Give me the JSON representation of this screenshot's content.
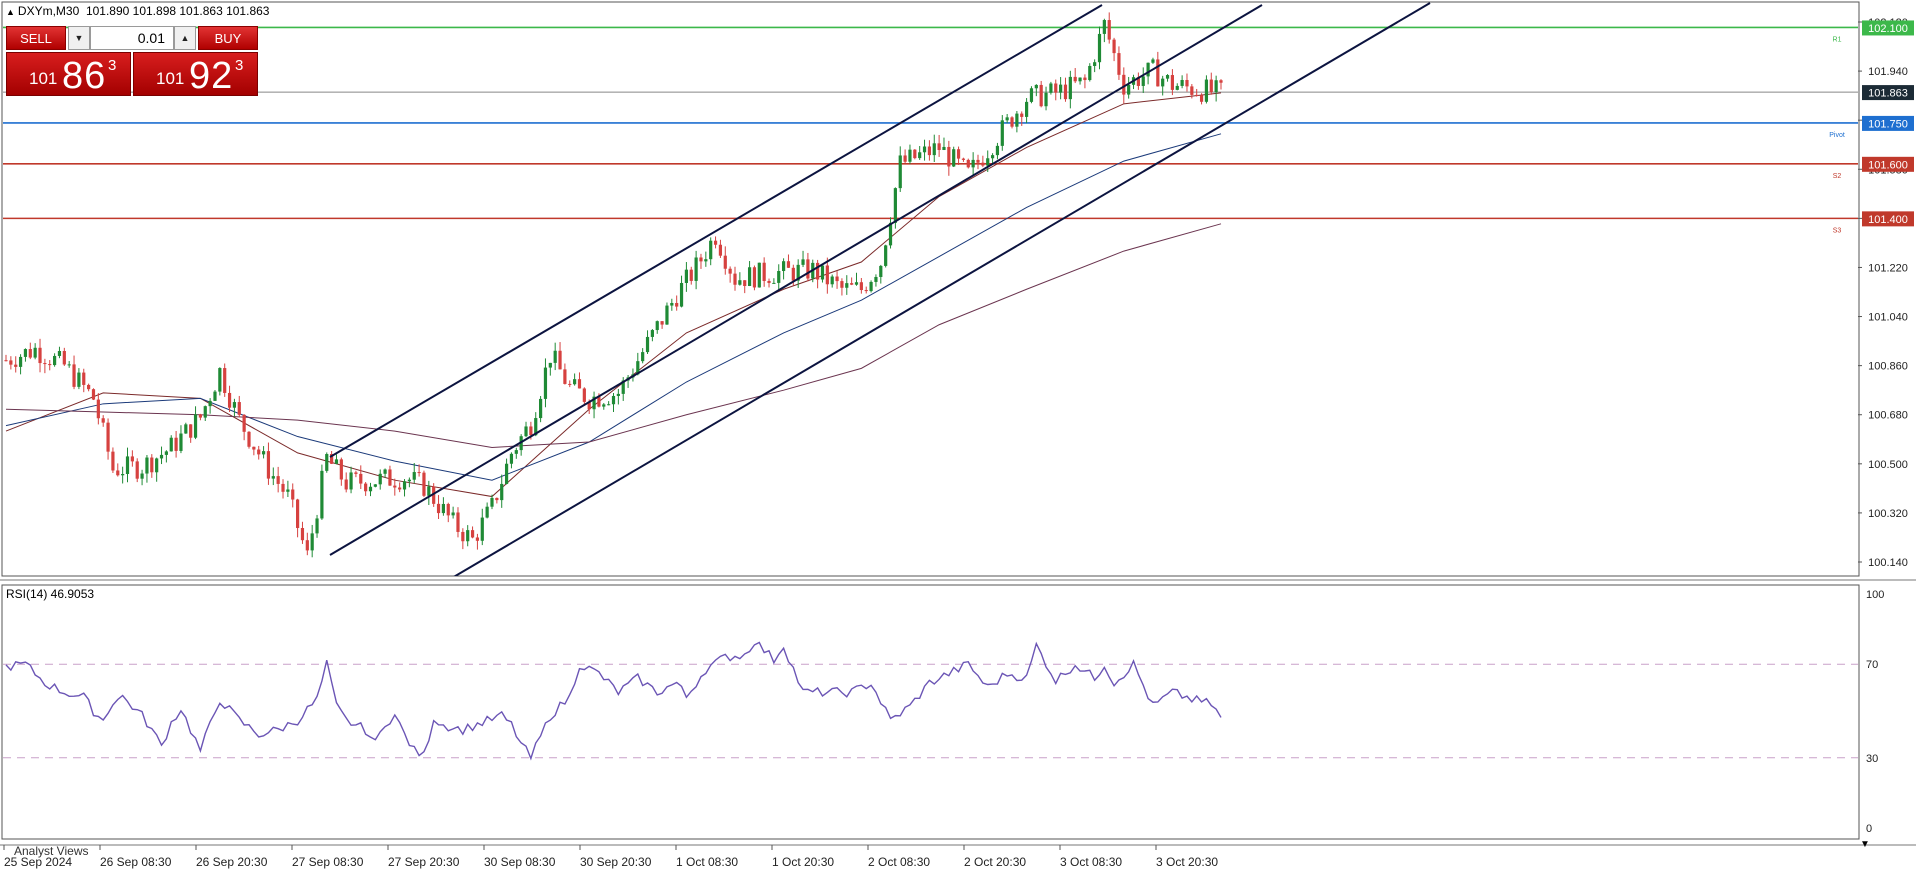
{
  "symbol": "DXYm,M30",
  "ohlc": "101.890 101.898 101.863 101.863",
  "trade_panel": {
    "sell_label": "SELL",
    "buy_label": "BUY",
    "lot": "0.01",
    "sell_price": {
      "small": "101",
      "big": "86",
      "sup": "3"
    },
    "buy_price": {
      "small": "101",
      "big": "92",
      "sup": "3"
    }
  },
  "colors": {
    "candle_up": "#1f8a35",
    "candle_down": "#d6413f",
    "r1": "#3cb84a",
    "pivot": "#1e6fd0",
    "s": "#c0392b",
    "bid": "#888888",
    "rsi": "#6b55b5",
    "channel": "#0c1440",
    "ma_fast": "#7b2a2a",
    "ma_mid": "#1b3a7a",
    "ma_slow": "#6b3550"
  },
  "chart_data": [
    {
      "type": "candlestick",
      "title": "DXYm,M30",
      "ylim": [
        100.05,
        102.16
      ],
      "ohlc_last": {
        "open": 101.89,
        "high": 101.898,
        "low": 101.863,
        "close": 101.863
      },
      "x_tick_labels": [
        "25 Sep 2024",
        "26 Sep 08:30",
        "26 Sep 20:30",
        "27 Sep 08:30",
        "27 Sep 20:30",
        "30 Sep 08:30",
        "30 Sep 20:30",
        "1 Oct 08:30",
        "1 Oct 20:30",
        "2 Oct 08:30",
        "2 Oct 20:30",
        "3 Oct 08:30",
        "3 Oct 20:30"
      ],
      "y_tick_labels": [
        "102.120",
        "101.940",
        "101.760",
        "101.580",
        "101.400",
        "101.220",
        "101.040",
        "100.860",
        "100.680",
        "100.500",
        "100.320",
        "100.140"
      ],
      "price_path": [
        [
          0,
          100.88
        ],
        [
          6,
          100.92
        ],
        [
          12,
          100.86
        ],
        [
          18,
          100.74
        ],
        [
          22,
          100.48
        ],
        [
          28,
          100.49
        ],
        [
          34,
          100.56
        ],
        [
          40,
          100.67
        ],
        [
          44,
          100.84
        ],
        [
          48,
          100.66
        ],
        [
          54,
          100.48
        ],
        [
          58,
          100.38
        ],
        [
          62,
          100.16
        ],
        [
          66,
          100.52
        ],
        [
          70,
          100.43
        ],
        [
          76,
          100.44
        ],
        [
          82,
          100.45
        ],
        [
          86,
          100.42
        ],
        [
          92,
          100.28
        ],
        [
          96,
          100.22
        ],
        [
          100,
          100.34
        ],
        [
          104,
          100.54
        ],
        [
          108,
          100.65
        ],
        [
          112,
          100.9
        ],
        [
          116,
          100.78
        ],
        [
          120,
          100.74
        ],
        [
          126,
          100.76
        ],
        [
          132,
          100.94
        ],
        [
          138,
          101.12
        ],
        [
          142,
          101.22
        ],
        [
          146,
          101.34
        ],
        [
          150,
          101.18
        ],
        [
          158,
          101.2
        ],
        [
          166,
          101.21
        ],
        [
          172,
          101.14
        ],
        [
          176,
          101.14
        ],
        [
          180,
          101.24
        ],
        [
          184,
          101.6
        ],
        [
          192,
          101.66
        ],
        [
          198,
          101.56
        ],
        [
          204,
          101.7
        ],
        [
          210,
          101.84
        ],
        [
          216,
          101.86
        ],
        [
          222,
          101.9
        ],
        [
          226,
          102.11
        ],
        [
          230,
          101.89
        ],
        [
          236,
          101.94
        ],
        [
          240,
          101.89
        ],
        [
          246,
          101.87
        ],
        [
          250,
          101.86
        ]
      ],
      "series": [
        {
          "name": "MA",
          "values": [
            [
              0,
              100.62
            ],
            [
              20,
              100.76
            ],
            [
              40,
              100.74
            ],
            [
              60,
              100.54
            ],
            [
              80,
              100.44
            ],
            [
              100,
              100.38
            ],
            [
              120,
              100.7
            ],
            [
              140,
              100.98
            ],
            [
              160,
              101.14
            ],
            [
              176,
              101.24
            ],
            [
              192,
              101.48
            ],
            [
              210,
              101.66
            ],
            [
              230,
              101.82
            ],
            [
              250,
              101.86
            ]
          ]
        },
        {
          "name": "MA",
          "values": [
            [
              0,
              100.64
            ],
            [
              20,
              100.72
            ],
            [
              40,
              100.74
            ],
            [
              60,
              100.6
            ],
            [
              80,
              100.51
            ],
            [
              100,
              100.44
            ],
            [
              120,
              100.58
            ],
            [
              140,
              100.8
            ],
            [
              160,
              100.98
            ],
            [
              176,
              101.1
            ],
            [
              192,
              101.26
            ],
            [
              210,
              101.44
            ],
            [
              230,
              101.61
            ],
            [
              250,
              101.71
            ]
          ]
        },
        {
          "name": "MA",
          "values": [
            [
              0,
              100.7
            ],
            [
              20,
              100.69
            ],
            [
              40,
              100.68
            ],
            [
              60,
              100.66
            ],
            [
              80,
              100.62
            ],
            [
              100,
              100.56
            ],
            [
              120,
              100.58
            ],
            [
              140,
              100.68
            ],
            [
              160,
              100.77
            ],
            [
              176,
              100.85
            ],
            [
              192,
              101.01
            ],
            [
              210,
              101.14
            ],
            [
              230,
              101.28
            ],
            [
              250,
              101.38
            ]
          ]
        }
      ],
      "horizontal_levels": [
        {
          "value": 102.1,
          "label": "102.100",
          "tag": "R1"
        },
        {
          "value": 101.75,
          "label": "101.750",
          "tag": "Pivot"
        },
        {
          "value": 101.6,
          "label": "101.600",
          "tag": "S2"
        },
        {
          "value": 101.4,
          "label": "101.400",
          "tag": "S3"
        }
      ],
      "current_price": {
        "value": 101.863,
        "label": "101.863"
      },
      "price_channel": {
        "lines": 3
      }
    },
    {
      "type": "line",
      "title": "RSI(14) 46.9053",
      "ylim": [
        0,
        100
      ],
      "y_tick_labels": [
        "100",
        "70",
        "30",
        "0"
      ],
      "levels": [
        70,
        30
      ],
      "series": [
        {
          "values": [
            [
              0,
              69
            ],
            [
              4,
              70
            ],
            [
              8,
              62
            ],
            [
              12,
              58
            ],
            [
              16,
              56
            ],
            [
              18,
              50
            ],
            [
              20,
              46
            ],
            [
              22,
              54
            ],
            [
              24,
              56
            ],
            [
              28,
              48
            ],
            [
              30,
              42
            ],
            [
              32,
              35
            ],
            [
              34,
              45
            ],
            [
              36,
              51
            ],
            [
              38,
              42
            ],
            [
              40,
              33
            ],
            [
              44,
              55
            ],
            [
              48,
              46
            ],
            [
              52,
              40
            ],
            [
              56,
              42
            ],
            [
              60,
              46
            ],
            [
              64,
              55
            ],
            [
              66,
              70
            ],
            [
              68,
              52
            ],
            [
              70,
              46
            ],
            [
              74,
              42
            ],
            [
              76,
              36
            ],
            [
              78,
              45
            ],
            [
              80,
              48
            ],
            [
              82,
              40
            ],
            [
              84,
              33
            ],
            [
              86,
              31
            ],
            [
              88,
              47
            ],
            [
              90,
              44
            ],
            [
              94,
              42
            ],
            [
              98,
              45
            ],
            [
              102,
              48
            ],
            [
              104,
              44
            ],
            [
              106,
              36
            ],
            [
              108,
              30
            ],
            [
              112,
              48
            ],
            [
              116,
              56
            ],
            [
              118,
              70
            ],
            [
              122,
              66
            ],
            [
              126,
              58
            ],
            [
              130,
              64
            ],
            [
              134,
              58
            ],
            [
              138,
              62
            ],
            [
              140,
              56
            ],
            [
              144,
              68
            ],
            [
              148,
              73
            ],
            [
              152,
              74
            ],
            [
              154,
              80
            ],
            [
              158,
              72
            ],
            [
              160,
              78
            ],
            [
              164,
              58
            ],
            [
              168,
              58
            ],
            [
              174,
              58
            ],
            [
              178,
              62
            ],
            [
              182,
              46
            ],
            [
              186,
              52
            ],
            [
              190,
              62
            ],
            [
              194,
              66
            ],
            [
              198,
              70
            ],
            [
              202,
              60
            ],
            [
              206,
              66
            ],
            [
              210,
              64
            ],
            [
              212,
              78
            ],
            [
              216,
              63
            ],
            [
              220,
              70
            ],
            [
              224,
              64
            ],
            [
              226,
              70
            ],
            [
              228,
              62
            ],
            [
              232,
              70
            ],
            [
              236,
              52
            ],
            [
              240,
              58
            ],
            [
              244,
              55
            ],
            [
              248,
              53
            ],
            [
              250,
              47
            ]
          ]
        }
      ]
    }
  ],
  "analyst_views": "Analyst Views"
}
